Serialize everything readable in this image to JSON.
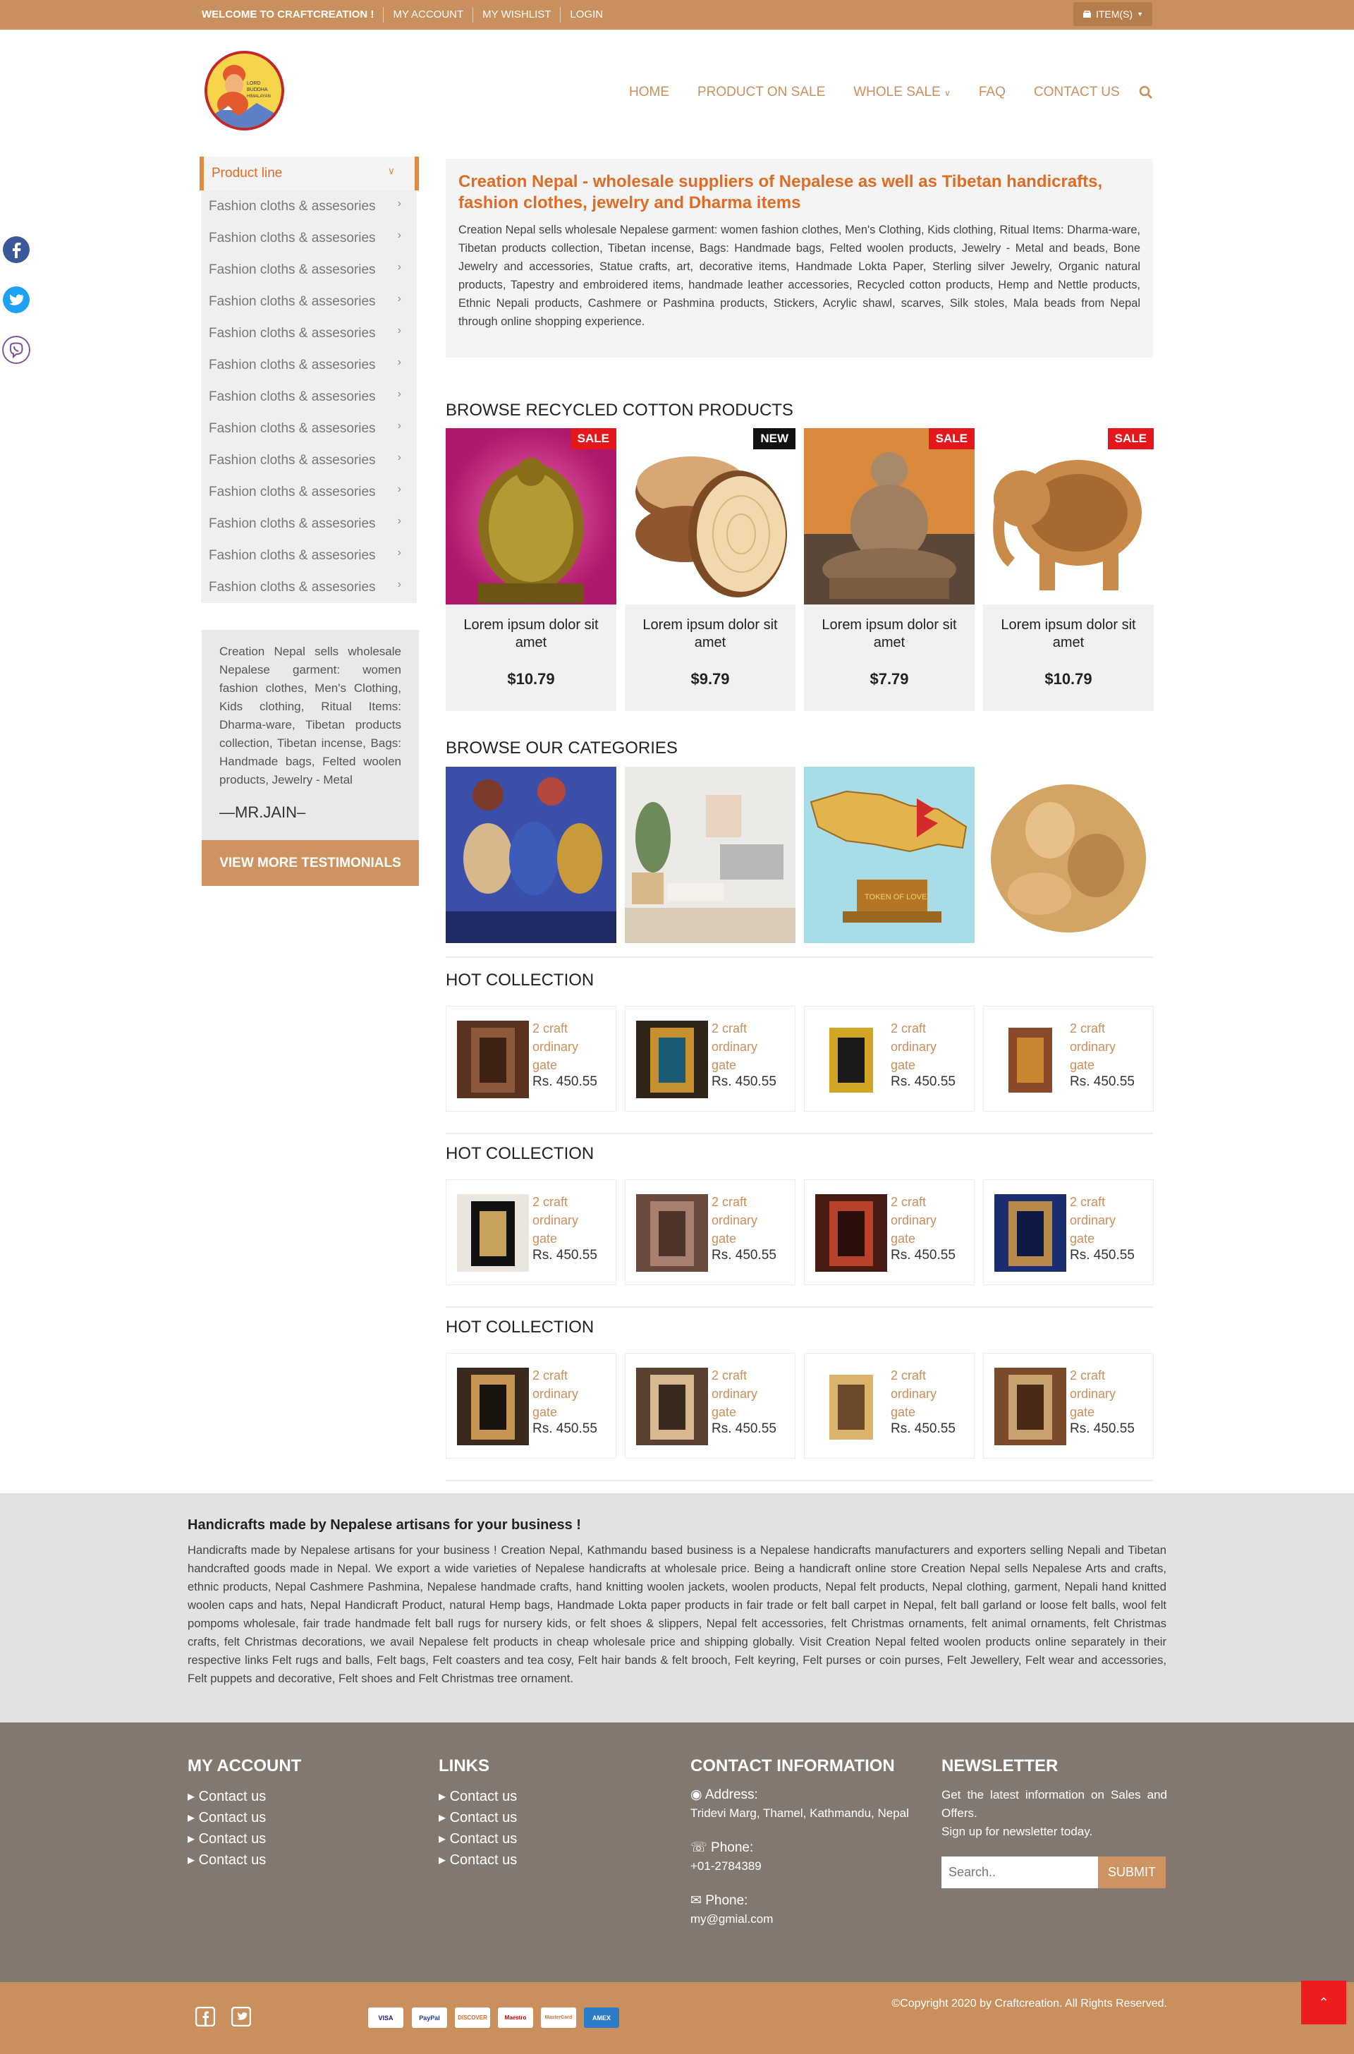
{
  "topbar": {
    "links": [
      "WELCOME TO CRAFTCREATION !",
      "MY ACCOUNT",
      "MY WISHLIST",
      "LOGIN"
    ],
    "cart_label": "ITEM(S)"
  },
  "logo": {
    "line1": "LORD",
    "line2": "BUDDHA",
    "line3": "HIMALAYAN"
  },
  "nav": [
    "HOME",
    "PRODUCT ON SALE",
    "WHOLE SALE",
    "FAQ",
    "CONTACT US"
  ],
  "sidebar": {
    "head": "Product line",
    "items": [
      "Fashion cloths & assesories",
      "Fashion cloths & assesories",
      "Fashion cloths & assesories",
      "Fashion cloths & assesories",
      "Fashion cloths & assesories",
      "Fashion cloths & assesories",
      "Fashion cloths & assesories",
      "Fashion cloths & assesories",
      "Fashion cloths & assesories",
      "Fashion cloths & assesories",
      "Fashion cloths & assesories",
      "Fashion cloths & assesories",
      "Fashion cloths & assesories"
    ],
    "testimonial": {
      "text": "Creation Nepal sells wholesale Nepalese garment: women fashion clothes, Men's Clothing, Kids clothing, Ritual Items: Dharma-ware, Tibetan products collection, Tibetan incense, Bags: Handmade bags, Felted woolen products, Jewelry - Metal",
      "author": "—MR.JAIN–",
      "button": "VIEW MORE TESTIMONIALS"
    }
  },
  "intro": {
    "title": "Creation Nepal - wholesale suppliers of Nepalese as well as Tibetan handicrafts, fashion clothes, jewelry and Dharma items",
    "body": "Creation Nepal sells wholesale Nepalese garment: women fashion clothes, Men's Clothing, Kids clothing, Ritual Items: Dharma-ware, Tibetan products collection, Tibetan incense, Bags: Handmade bags, Felted woolen products, Jewelry - Metal and beads, Bone Jewelry and accessories, Statue crafts, art, decorative items, Handmade Lokta Paper, Sterling silver Jewelry, Organic natural products, Tapestry and embroidered items, handmade leather accessories, Recycled cotton products, Hemp and Nettle products, Ethnic Nepali products, Cashmere or Pashmina products, Stickers, Acrylic shawl, scarves, Silk stoles, Mala beads from Nepal through online shopping experience."
  },
  "recycled": {
    "title": "BROWSE RECYCLED COTTON PRODUCTS",
    "products": [
      {
        "badge": "SALE",
        "name": "Lorem ipsum dolor sit amet",
        "price": "$10.79"
      },
      {
        "badge": "NEW",
        "name": "Lorem ipsum dolor sit amet",
        "price": "$9.79"
      },
      {
        "badge": "SALE",
        "name": "Lorem ipsum dolor sit amet",
        "price": "$7.79"
      },
      {
        "badge": "SALE",
        "name": "Lorem ipsum dolor sit amet",
        "price": "$10.79"
      }
    ]
  },
  "categories": {
    "title": "BROWSE OUR CATEGORIES",
    "map_sign": "TOKEN OF LOVE"
  },
  "hot": [
    {
      "title": "HOT COLLECTION",
      "items": [
        {
          "name": "2 craft ordinary gate",
          "price": "Rs. 450.55"
        },
        {
          "name": "2 craft ordinary gate",
          "price": "Rs. 450.55"
        },
        {
          "name": "2 craft ordinary gate",
          "price": "Rs. 450.55"
        },
        {
          "name": "2 craft ordinary gate",
          "price": "Rs. 450.55"
        }
      ]
    },
    {
      "title": "HOT COLLECTION",
      "items": [
        {
          "name": "2 craft ordinary gate",
          "price": "Rs. 450.55"
        },
        {
          "name": "2 craft ordinary gate",
          "price": "Rs. 450.55"
        },
        {
          "name": "2 craft ordinary gate",
          "price": "Rs. 450.55"
        },
        {
          "name": "2 craft ordinary gate",
          "price": "Rs. 450.55"
        }
      ]
    },
    {
      "title": "HOT COLLECTION",
      "items": [
        {
          "name": "2 craft ordinary gate",
          "price": "Rs. 450.55"
        },
        {
          "name": "2 craft ordinary gate",
          "price": "Rs. 450.55"
        },
        {
          "name": "2 craft ordinary gate",
          "price": "Rs. 450.55"
        },
        {
          "name": "2 craft ordinary gate",
          "price": "Rs. 450.55"
        }
      ]
    }
  ],
  "info": {
    "title": "Handicrafts made by Nepalese artisans for your business !",
    "body": "Handicrafts made by Nepalese artisans for your business ! Creation Nepal, Kathmandu based business is a Nepalese handicrafts manufacturers and exporters selling Nepali and Tibetan handcrafted goods made in Nepal. We export a wide varieties of Nepalese handicrafts at wholesale price. Being a handicraft online store Creation Nepal sells Nepalese Arts and crafts, ethnic products, Nepal Cashmere Pashmina, Nepalese handmade crafts, hand knitting woolen jackets, woolen products, Nepal felt products, Nepal clothing, garment, Nepali hand knitted woolen caps and hats, Nepal Handicraft Product, natural Hemp bags, Handmade Lokta paper products in fair trade or felt ball carpet in Nepal, felt ball garland or loose felt balls, wool felt pompoms wholesale, fair trade handmade felt ball rugs for nursery kids, or felt shoes & slippers, Nepal felt accessories, felt Christmas ornaments, felt animal ornaments, felt Christmas crafts, felt Christmas decorations, we avail Nepalese felt products in cheap wholesale price and shipping globally. Visit Creation Nepal felted woolen products online separately in their respective links Felt rugs and balls, Felt bags, Felt coasters and tea cosy, Felt hair bands & felt brooch, Felt keyring, Felt purses or coin purses, Felt Jewellery, Felt wear and accessories, Felt puppets and decorative, Felt shoes and Felt Christmas tree ornament."
  },
  "footer": {
    "account": {
      "title": "MY ACCOUNT",
      "links": [
        "Contact us",
        "Contact us",
        "Contact us",
        "Contact us"
      ]
    },
    "links": {
      "title": "LINKS",
      "links": [
        "Contact us",
        "Contact us",
        "Contact us",
        "Contact us"
      ]
    },
    "contact": {
      "title": "CONTACT INFORMATION",
      "address_label": "Address:",
      "address": "Tridevi Marg, Thamel, Kathmandu, Nepal",
      "phone_label": "Phone:",
      "phone": "+01-2784389",
      "email_label": "Phone:",
      "email": "my@gmial.com"
    },
    "newsletter": {
      "title": "NEWSLETTER",
      "text1": "Get the latest information on Sales and Offers.",
      "text2": "Sign up for newsletter today.",
      "placeholder": "Search..",
      "submit": "SUBMIT"
    }
  },
  "bottom": {
    "payments": [
      "VISA",
      "PayPal",
      "DISCOVER",
      "Maestro",
      "MasterCard",
      "AMEX"
    ],
    "copyright": "©Copyright 2020 by Craftcreation. All Rights Reserved."
  }
}
